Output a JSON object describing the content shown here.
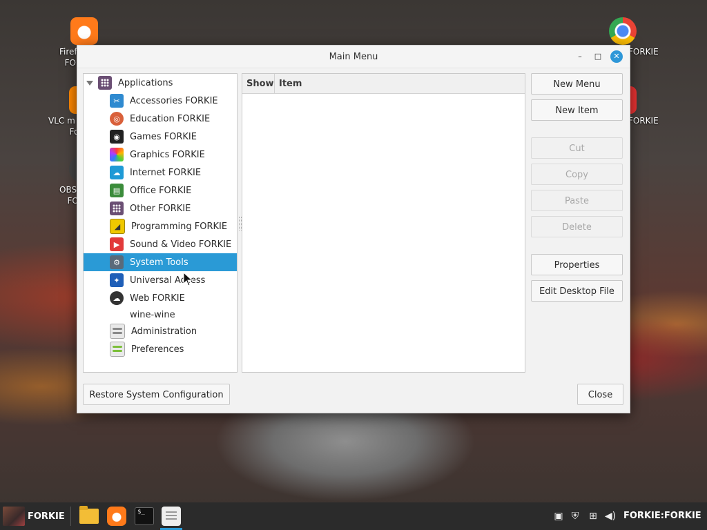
{
  "desktop": {
    "icons": [
      {
        "label": "Firef…\nFO…"
      },
      {
        "label": "VLC m…\nFO…"
      },
      {
        "label": "OBS…\nFO…"
      },
      {
        "label": "FORKIE"
      },
      {
        "label": "FORKIE"
      }
    ]
  },
  "window": {
    "title": "Main Menu",
    "minimize_glyph": "–",
    "maximize_glyph": "□",
    "close_glyph": "✕"
  },
  "tree": {
    "root_label": "Applications",
    "items": [
      {
        "label": "Accessories FORKIE",
        "icon": "accessories-icon"
      },
      {
        "label": "Education FORKIE",
        "icon": "education-icon"
      },
      {
        "label": "Games FORKIE",
        "icon": "games-icon"
      },
      {
        "label": "Graphics FORKIE",
        "icon": "graphics-icon"
      },
      {
        "label": "Internet FORKIE",
        "icon": "internet-icon"
      },
      {
        "label": "Office FORKIE",
        "icon": "office-icon"
      },
      {
        "label": "Other FORKIE",
        "icon": "other-icon"
      },
      {
        "label": "Programming FORKIE",
        "icon": "programming-icon"
      },
      {
        "label": "Sound & Video FORKIE",
        "icon": "sound-video-icon"
      },
      {
        "label": "System Tools",
        "icon": "system-tools-icon",
        "selected": true
      },
      {
        "label": "Universal Access",
        "icon": "universal-access-icon"
      },
      {
        "label": "Web FORKIE",
        "icon": "web-icon"
      },
      {
        "label": "wine-wine",
        "icon": "none"
      },
      {
        "label": "Administration",
        "icon": "administration-icon"
      },
      {
        "label": "Preferences",
        "icon": "preferences-icon"
      }
    ]
  },
  "item_list": {
    "columns": [
      "Show",
      "Item"
    ]
  },
  "buttons": {
    "new_menu": "New Menu",
    "new_item": "New Item",
    "cut": "Cut",
    "copy": "Copy",
    "paste": "Paste",
    "delete": "Delete",
    "properties": "Properties",
    "edit_desktop_file": "Edit Desktop File",
    "restore": "Restore System Configuration",
    "close": "Close"
  },
  "taskbar": {
    "start_label": "FORKIE",
    "user_label": "FORKIE:FORKIE",
    "terminal_glyph": "$_"
  },
  "colors": {
    "selection": "#2a9ad6",
    "close_button": "#2e97d8",
    "taskbar": "#2b2b2b"
  }
}
